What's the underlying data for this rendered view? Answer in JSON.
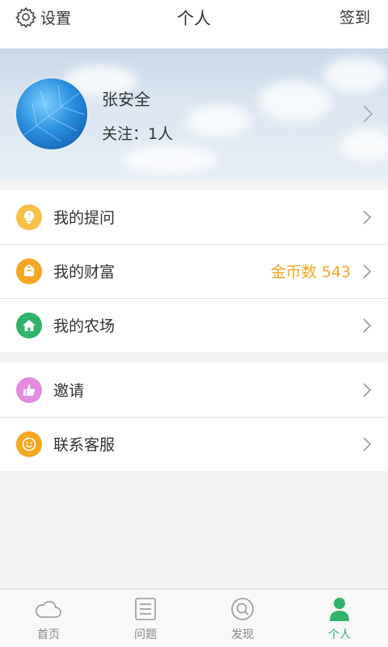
{
  "header": {
    "settings_label": "设置",
    "title": "个人",
    "checkin_label": "签到"
  },
  "profile": {
    "name": "张安全",
    "follow_text": "关注：1人"
  },
  "menu_group_1": [
    {
      "label": "我的提问",
      "icon": "lightbulb-icon",
      "color": "#f7c14a"
    },
    {
      "label": "我的财富",
      "icon": "wealth-icon",
      "color": "#f5a623",
      "value": "金币数 543"
    },
    {
      "label": "我的农场",
      "icon": "home-icon",
      "color": "#2fb36b"
    }
  ],
  "menu_group_2": [
    {
      "label": "邀请",
      "icon": "thumbs-up-icon",
      "color": "#e58be0"
    },
    {
      "label": "联系客服",
      "icon": "smiley-icon",
      "color": "#f5a623"
    }
  ],
  "tabbar": {
    "tabs": [
      {
        "label": "首页",
        "icon": "cloud-icon"
      },
      {
        "label": "问题",
        "icon": "list-icon"
      },
      {
        "label": "发现",
        "icon": "search-icon"
      },
      {
        "label": "个人",
        "icon": "person-icon",
        "active": true
      }
    ],
    "active_color": "#2fb36b"
  }
}
